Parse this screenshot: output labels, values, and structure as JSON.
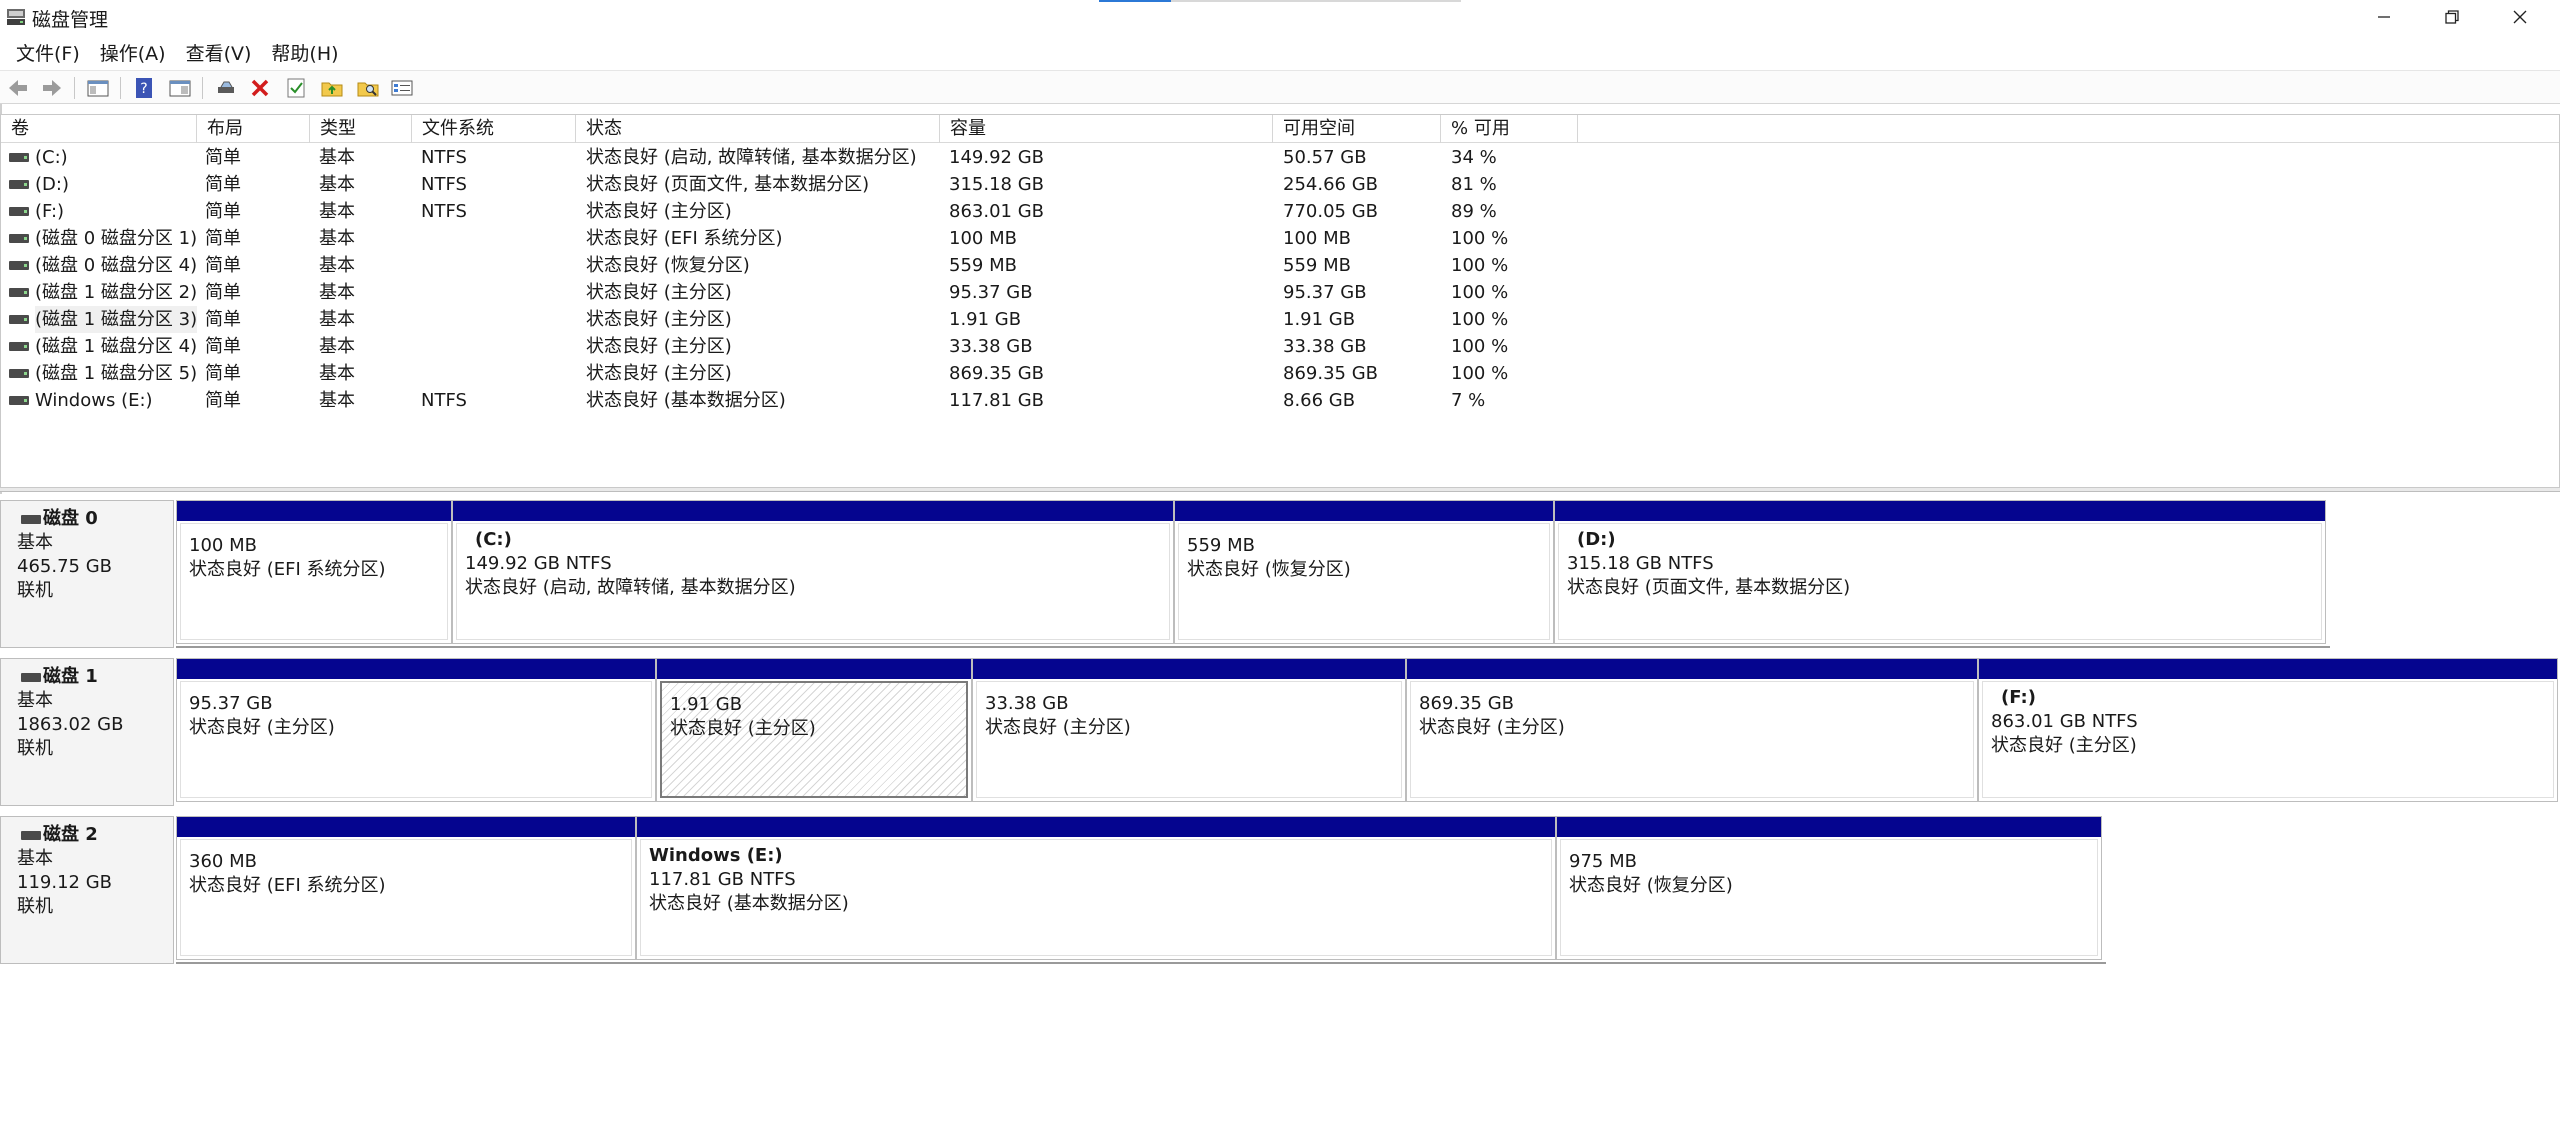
{
  "window": {
    "title": "磁盘管理"
  },
  "menu": [
    "文件(F)",
    "操作(A)",
    "查看(V)",
    "帮助(H)"
  ],
  "toolbar_icons": [
    "back-arrow-icon",
    "forward-arrow-icon",
    "console-tree-icon",
    "help-icon",
    "properties-view-icon",
    "connect-drive-icon",
    "delete-icon",
    "check-icon",
    "folder-up-icon",
    "folder-search-icon",
    "list-settings-icon"
  ],
  "volume_list": {
    "columns": [
      "卷",
      "布局",
      "类型",
      "文件系统",
      "状态",
      "容量",
      "可用空间",
      "% 可用"
    ],
    "rows": [
      [
        "(C:)",
        "简单",
        "基本",
        "NTFS",
        "状态良好 (启动, 故障转储, 基本数据分区)",
        "149.92 GB",
        "50.57 GB",
        "34 %"
      ],
      [
        "(D:)",
        "简单",
        "基本",
        "NTFS",
        "状态良好 (页面文件, 基本数据分区)",
        "315.18 GB",
        "254.66 GB",
        "81 %"
      ],
      [
        "(F:)",
        "简单",
        "基本",
        "NTFS",
        "状态良好 (主分区)",
        "863.01 GB",
        "770.05 GB",
        "89 %"
      ],
      [
        "(磁盘 0 磁盘分区 1)",
        "简单",
        "基本",
        "",
        "状态良好 (EFI 系统分区)",
        "100 MB",
        "100 MB",
        "100 %"
      ],
      [
        "(磁盘 0 磁盘分区 4)",
        "简单",
        "基本",
        "",
        "状态良好 (恢复分区)",
        "559 MB",
        "559 MB",
        "100 %"
      ],
      [
        "(磁盘 1 磁盘分区 2)",
        "简单",
        "基本",
        "",
        "状态良好 (主分区)",
        "95.37 GB",
        "95.37 GB",
        "100 %"
      ],
      [
        "(磁盘 1 磁盘分区 3)",
        "简单",
        "基本",
        "",
        "状态良好 (主分区)",
        "1.91 GB",
        "1.91 GB",
        "100 %"
      ],
      [
        "(磁盘 1 磁盘分区 4)",
        "简单",
        "基本",
        "",
        "状态良好 (主分区)",
        "33.38 GB",
        "33.38 GB",
        "100 %"
      ],
      [
        "(磁盘 1 磁盘分区 5)",
        "简单",
        "基本",
        "",
        "状态良好 (主分区)",
        "869.35 GB",
        "869.35 GB",
        "100 %"
      ],
      [
        "Windows (E:)",
        "简单",
        "基本",
        "NTFS",
        "状态良好 (基本数据分区)",
        "117.81 GB",
        "8.66 GB",
        "7 %"
      ]
    ]
  },
  "disks": [
    {
      "name": "磁盘 0",
      "type": "基本",
      "size": "465.75 GB",
      "status": "联机",
      "partitions": [
        {
          "name": "",
          "size": "100 MB",
          "status": "状态良好 (EFI 系统分区)"
        },
        {
          "name": "(C:)",
          "size": "149.92 GB NTFS",
          "status": "状态良好 (启动, 故障转储, 基本数据分区)"
        },
        {
          "name": "",
          "size": "559 MB",
          "status": "状态良好 (恢复分区)"
        },
        {
          "name": "(D:)",
          "size": "315.18 GB NTFS",
          "status": "状态良好 (页面文件, 基本数据分区)"
        }
      ]
    },
    {
      "name": "磁盘 1",
      "type": "基本",
      "size": "1863.02 GB",
      "status": "联机",
      "partitions": [
        {
          "name": "",
          "size": "95.37 GB",
          "status": "状态良好 (主分区)"
        },
        {
          "name": "",
          "size": "1.91 GB",
          "status": "状态良好 (主分区)"
        },
        {
          "name": "",
          "size": "33.38 GB",
          "status": "状态良好 (主分区)"
        },
        {
          "name": "",
          "size": "869.35 GB",
          "status": "状态良好 (主分区)"
        },
        {
          "name": "(F:)",
          "size": "863.01 GB NTFS",
          "status": "状态良好 (主分区)"
        }
      ]
    },
    {
      "name": "磁盘 2",
      "type": "基本",
      "size": "119.12 GB",
      "status": "联机",
      "partitions": [
        {
          "name": "",
          "size": "360 MB",
          "status": "状态良好 (EFI 系统分区)"
        },
        {
          "name": "Windows  (E:)",
          "size": "117.81 GB NTFS",
          "status": "状态良好 (基本数据分区)"
        },
        {
          "name": "",
          "size": "975 MB",
          "status": "状态良好 (恢复分区)"
        }
      ]
    }
  ]
}
